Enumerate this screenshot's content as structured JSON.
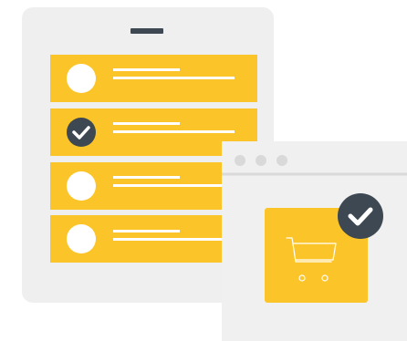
{
  "colors": {
    "panel": "#efefef",
    "panel_border": "#dedede",
    "yellow": "#fbc52a",
    "dark": "#3d4852",
    "white": "#ffffff",
    "window_bg": "#f0f0f0",
    "window_dots": "#d9d9d9"
  },
  "phone": {
    "handle_icon": "speaker-bar",
    "items": [
      {
        "state": "unselected",
        "indicator_icon": "empty-circle"
      },
      {
        "state": "selected",
        "indicator_icon": "check-circle-icon"
      },
      {
        "state": "unselected",
        "indicator_icon": "empty-circle"
      },
      {
        "state": "unselected",
        "indicator_icon": "empty-circle"
      }
    ]
  },
  "browser": {
    "controls": [
      "dot",
      "dot",
      "dot"
    ],
    "product_icon": "shopping-cart-icon",
    "badge_icon": "check-circle-icon"
  }
}
